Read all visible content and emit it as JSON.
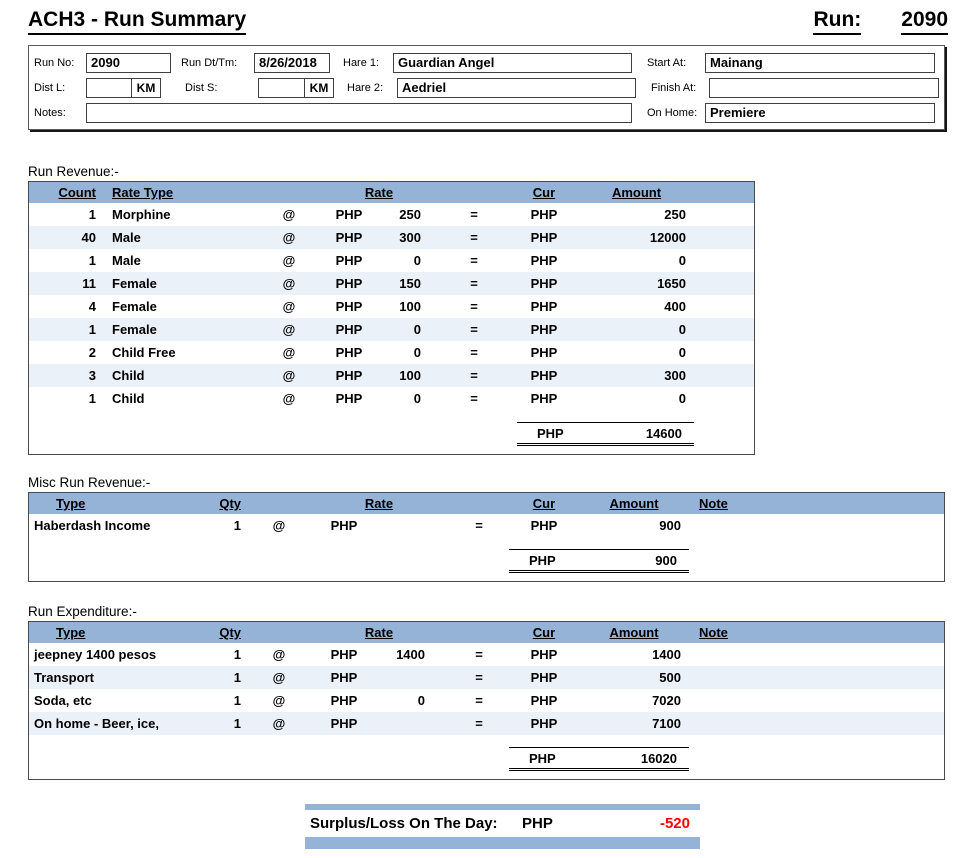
{
  "header": {
    "title": "ACH3 - Run Summary",
    "run_label": "Run:",
    "run_number": "2090"
  },
  "details": {
    "run_no_label": "Run No:",
    "run_no_value": "2090",
    "run_dt_label": "Run Dt/Tm:",
    "run_dt_value": "8/26/2018",
    "hare1_label": "Hare 1:",
    "hare1_value": "Guardian Angel",
    "start_at_label": "Start At:",
    "start_at_value": "Mainang",
    "dist_l_label": "Dist L:",
    "dist_l_value": "",
    "dist_l_unit": "KM",
    "dist_s_label": "Dist S:",
    "dist_s_value": "",
    "dist_s_unit": "KM",
    "hare2_label": "Hare 2:",
    "hare2_value": "Aedriel",
    "finish_at_label": "Finish At:",
    "finish_at_value": "",
    "notes_label": "Notes:",
    "notes_value": "",
    "on_home_label": "On Home:",
    "on_home_value": "Premiere"
  },
  "symbols": {
    "at": "@",
    "equals": "="
  },
  "revenue": {
    "section_label": "Run Revenue:-",
    "headers": {
      "count": "Count",
      "rate_type": "Rate Type",
      "rate": "Rate",
      "cur": "Cur",
      "amount": "Amount"
    },
    "rows": [
      {
        "count": "1",
        "rate_type": "Morphine",
        "cur1": "PHP",
        "rate": "250",
        "cur2": "PHP",
        "amount": "250"
      },
      {
        "count": "40",
        "rate_type": "Male",
        "cur1": "PHP",
        "rate": "300",
        "cur2": "PHP",
        "amount": "12000"
      },
      {
        "count": "1",
        "rate_type": "Male",
        "cur1": "PHP",
        "rate": "0",
        "cur2": "PHP",
        "amount": "0"
      },
      {
        "count": "11",
        "rate_type": "Female",
        "cur1": "PHP",
        "rate": "150",
        "cur2": "PHP",
        "amount": "1650"
      },
      {
        "count": "4",
        "rate_type": "Female",
        "cur1": "PHP",
        "rate": "100",
        "cur2": "PHP",
        "amount": "400"
      },
      {
        "count": "1",
        "rate_type": "Female",
        "cur1": "PHP",
        "rate": "0",
        "cur2": "PHP",
        "amount": "0"
      },
      {
        "count": "2",
        "rate_type": "Child Free",
        "cur1": "PHP",
        "rate": "0",
        "cur2": "PHP",
        "amount": "0"
      },
      {
        "count": "3",
        "rate_type": "Child",
        "cur1": "PHP",
        "rate": "100",
        "cur2": "PHP",
        "amount": "300"
      },
      {
        "count": "1",
        "rate_type": "Child",
        "cur1": "PHP",
        "rate": "0",
        "cur2": "PHP",
        "amount": "0"
      }
    ],
    "total": {
      "cur": "PHP",
      "amount": "14600"
    }
  },
  "misc_revenue": {
    "section_label": "Misc Run Revenue:-",
    "headers": {
      "type": "Type",
      "qty": "Qty",
      "rate": "Rate",
      "cur": "Cur",
      "amount": "Amount",
      "note": "Note"
    },
    "rows": [
      {
        "type": "Haberdash Income",
        "qty": "1",
        "cur1": "PHP",
        "rate": "",
        "cur2": "PHP",
        "amount": "900",
        "note": ""
      }
    ],
    "total": {
      "cur": "PHP",
      "amount": "900"
    }
  },
  "expenditure": {
    "section_label": "Run Expenditure:-",
    "headers": {
      "type": "Type",
      "qty": "Qty",
      "rate": "Rate",
      "cur": "Cur",
      "amount": "Amount",
      "note": "Note"
    },
    "rows": [
      {
        "type": "jeepney 1400 pesos",
        "qty": "1",
        "cur1": "PHP",
        "rate": "1400",
        "cur2": "PHP",
        "amount": "1400",
        "note": ""
      },
      {
        "type": "Transport",
        "qty": "1",
        "cur1": "PHP",
        "rate": "",
        "cur2": "PHP",
        "amount": "500",
        "note": ""
      },
      {
        "type": "Soda, etc",
        "qty": "1",
        "cur1": "PHP",
        "rate": "0",
        "cur2": "PHP",
        "amount": "7020",
        "note": ""
      },
      {
        "type": "On home - Beer, ice,",
        "qty": "1",
        "cur1": "PHP",
        "rate": "",
        "cur2": "PHP",
        "amount": "7100",
        "note": ""
      }
    ],
    "total": {
      "cur": "PHP",
      "amount": "16020"
    }
  },
  "summary": {
    "label": "Surplus/Loss On The Day:",
    "cur": "PHP",
    "amount": "-520"
  },
  "colors": {
    "header_bar": "#95B3D7",
    "row_alt": "#EAF1F9",
    "negative": "#FF0000"
  }
}
